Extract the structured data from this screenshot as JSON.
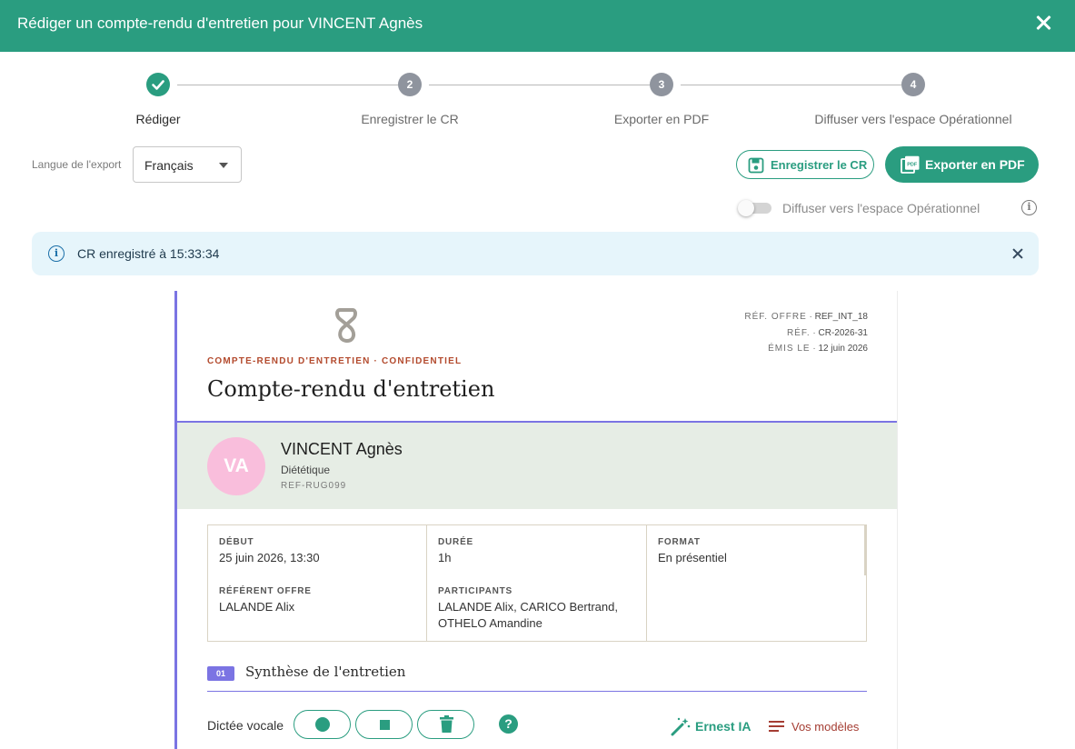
{
  "header": {
    "title": "Rédiger un compte-rendu d'entretien pour VINCENT Agnès"
  },
  "stepper": {
    "steps": [
      {
        "label": "Rédiger",
        "number": "1",
        "state": "done"
      },
      {
        "label": "Enregistrer le CR",
        "number": "2",
        "state": "pending"
      },
      {
        "label": "Exporter en PDF",
        "number": "3",
        "state": "pending"
      },
      {
        "label": "Diffuser vers l'espace Opérationnel",
        "number": "4",
        "state": "pending"
      }
    ]
  },
  "toolbar": {
    "lang_label": "Langue de l'export",
    "lang_value": "Français",
    "save_label": "Enregistrer le CR",
    "export_label": "Exporter en PDF",
    "diffuse_label": "Diffuser vers l'espace Opérationnel",
    "diffuse_enabled": false
  },
  "alert": {
    "text": "CR enregistré à 15:33:34"
  },
  "document": {
    "kicker": "COMPTE-RENDU D'ENTRETIEN · CONFIDENTIEL",
    "title": "Compte-rendu d'entretien",
    "refs": [
      {
        "key": "RÉF. OFFRE",
        "value": "REF_INT_18"
      },
      {
        "key": "RÉF.",
        "value": "CR-2026-31"
      },
      {
        "key": "ÉMIS LE",
        "value": "12 juin 2026"
      }
    ],
    "candidate": {
      "initials": "VA",
      "name": "VINCENT Agnès",
      "specialty": "Diététique",
      "ref": "REF-RUG099"
    },
    "meta": {
      "debut_label": "DÉBUT",
      "debut_value": "25 juin 2026, 13:30",
      "referent_label": "RÉFÉRENT OFFRE",
      "referent_value": "LALANDE Alix",
      "duree_label": "DURÉE",
      "duree_value": "1h",
      "participants_label": "PARTICIPANTS",
      "participants_value": "LALANDE Alix, CARICO Bertrand, OTHELO Amandine",
      "format_label": "FORMAT",
      "format_value": "En présentiel"
    },
    "section": {
      "number": "01",
      "title": "Synthèse de l'entretien"
    },
    "dictation": {
      "label": "Dictée vocale",
      "ia_label": "Ernest IA",
      "templates_label": "Vos modèles"
    }
  },
  "colors": {
    "primary": "#2a9d80",
    "accent": "#7b74e3",
    "kicker": "#b34a2d",
    "avatar": "#f9bedc"
  }
}
